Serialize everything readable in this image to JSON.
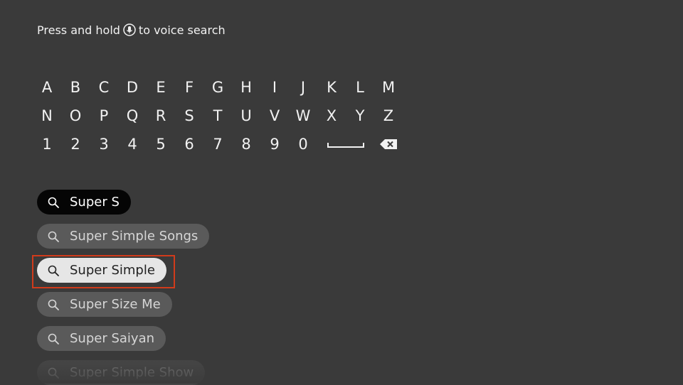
{
  "hint": {
    "before": "Press and hold",
    "icon": "mic-icon",
    "after": "to voice search"
  },
  "keyboard": {
    "rows": [
      [
        "A",
        "B",
        "C",
        "D",
        "E",
        "F",
        "G",
        "H",
        "I",
        "J",
        "K",
        "L",
        "M"
      ],
      [
        "N",
        "O",
        "P",
        "Q",
        "R",
        "S",
        "T",
        "U",
        "V",
        "W",
        "X",
        "Y",
        "Z"
      ],
      [
        "1",
        "2",
        "3",
        "4",
        "5",
        "6",
        "7",
        "8",
        "9",
        "0"
      ]
    ],
    "space_icon": "space-icon",
    "backspace_icon": "backspace-icon"
  },
  "suggestions": [
    {
      "text": "Super S",
      "state": "query"
    },
    {
      "text": "Super Simple Songs",
      "state": "normal"
    },
    {
      "text": "Super Simple",
      "state": "focused"
    },
    {
      "text": "Super Size Me",
      "state": "normal"
    },
    {
      "text": "Super Saiyan",
      "state": "normal"
    },
    {
      "text": "Super Simple Show",
      "state": "faded"
    }
  ],
  "colors": {
    "background": "#3a3a3a",
    "focus_ring": "#d13b1b",
    "query_pill": "#050505",
    "focused_pill": "#e6e6e6",
    "pill": "#5a5a5a"
  }
}
